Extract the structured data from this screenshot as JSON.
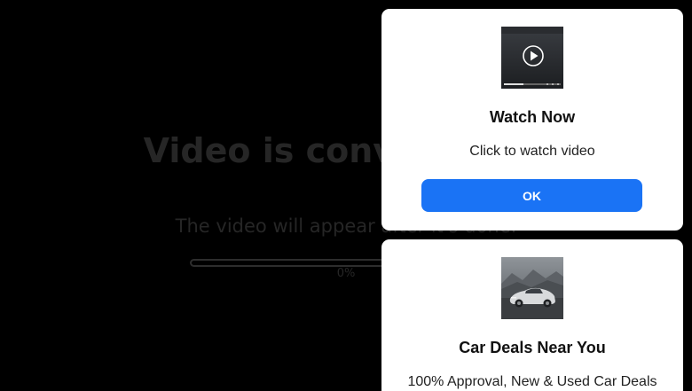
{
  "background": {
    "headline": "Video is converting...",
    "subline": "The video will appear after it's done.",
    "progress": {
      "label": "0%",
      "value": 0
    }
  },
  "notifications": [
    {
      "image": "video-thumbnail-play-icon",
      "title": "Watch Now",
      "description": "Click to watch video",
      "button_label": "OK"
    },
    {
      "image": "car-photo",
      "title": "Car Deals Near You",
      "description": "100% Approval, New & Used Car Deals"
    }
  ],
  "colors": {
    "page_bg": "#000000",
    "dim_text": "#262626",
    "card_bg": "#ffffff",
    "button_bg": "#1a73f5",
    "button_text": "#ffffff"
  }
}
